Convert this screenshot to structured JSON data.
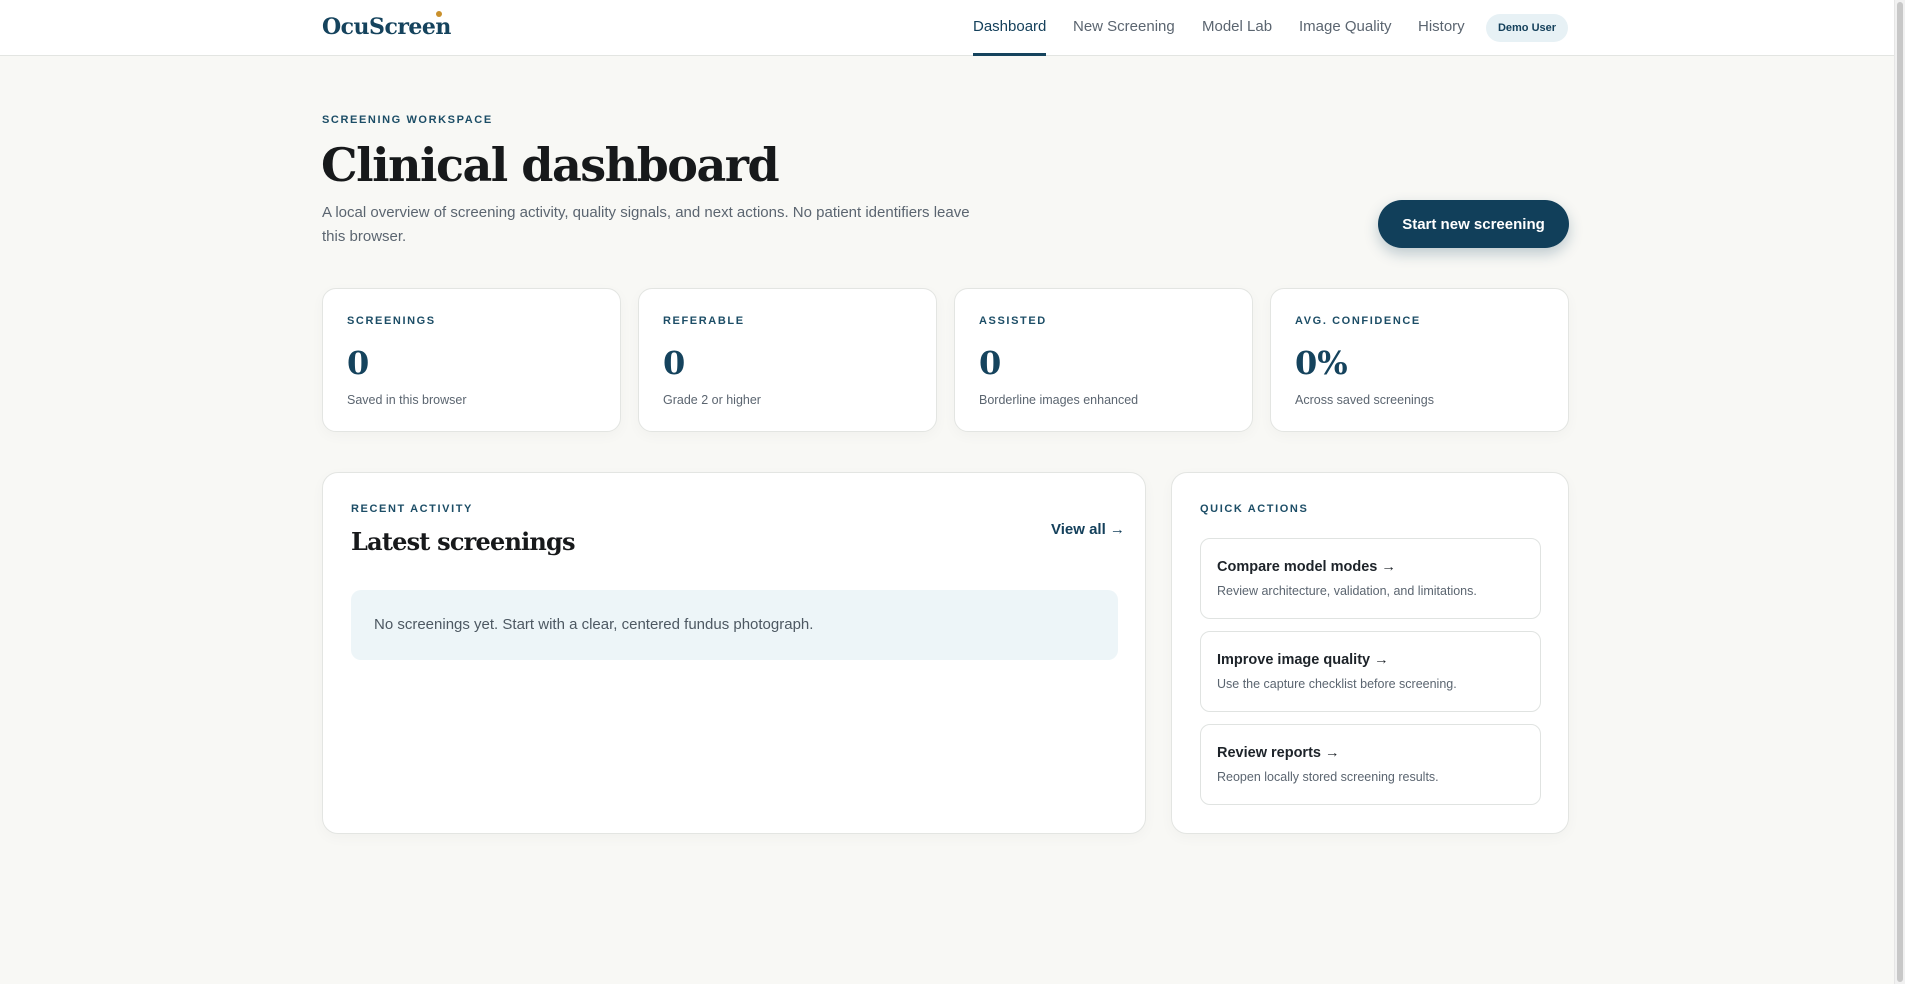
{
  "brand": {
    "name": "OcuScreen"
  },
  "nav": {
    "items": [
      {
        "label": "Dashboard",
        "active": true
      },
      {
        "label": "New Screening",
        "active": false
      },
      {
        "label": "Model Lab",
        "active": false
      },
      {
        "label": "Image Quality",
        "active": false
      },
      {
        "label": "History",
        "active": false
      }
    ],
    "user_label": "Demo User"
  },
  "header": {
    "eyebrow": "SCREENING WORKSPACE",
    "title": "Clinical dashboard",
    "description": "A local overview of screening activity, quality signals, and next actions. No patient identifiers leave this browser.",
    "primary_button": "Start new screening"
  },
  "stats": [
    {
      "label": "SCREENINGS",
      "value": "0",
      "sub": "Saved in this browser"
    },
    {
      "label": "REFERABLE",
      "value": "0",
      "sub": "Grade 2 or higher"
    },
    {
      "label": "ASSISTED",
      "value": "0",
      "sub": "Borderline images enhanced"
    },
    {
      "label": "AVG. CONFIDENCE",
      "value": "0%",
      "sub": "Across saved screenings"
    }
  ],
  "activity": {
    "eyebrow": "RECENT ACTIVITY",
    "title": "Latest screenings",
    "view_all": "View all →",
    "empty_message": "No screenings yet. Start with a clear, centered fundus photograph."
  },
  "quick_actions": {
    "eyebrow": "QUICK ACTIONS",
    "items": [
      {
        "title": "Compare model modes →",
        "sub": "Review architecture, validation, and limitations."
      },
      {
        "title": "Improve image quality →",
        "sub": "Use the capture checklist before screening."
      },
      {
        "title": "Review reports →",
        "sub": "Reopen locally stored screening results."
      }
    ]
  },
  "colors": {
    "brand": "#15435d",
    "accent_dot": "#c9902c",
    "background": "#f8f8f5",
    "empty_state_bg": "#edf5f8"
  }
}
